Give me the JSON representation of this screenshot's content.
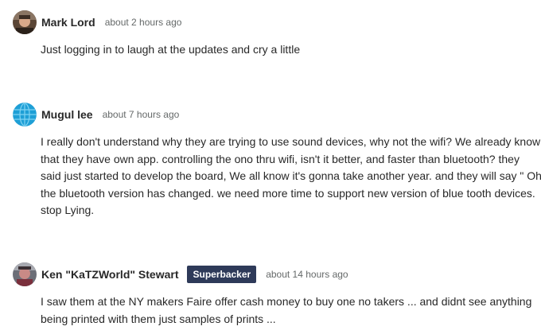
{
  "comments": [
    {
      "author": "Mark Lord",
      "badge": "",
      "time": "about 2 hours ago",
      "body": "Just logging in to laugh at the updates and cry a little"
    },
    {
      "author": "Mugul lee",
      "badge": "",
      "time": "about 7 hours ago",
      "body": "I really don't understand why they are trying to use sound devices, why not the wifi? We already know that they have own app. controlling the ono thru wifi, isn't it better, and faster than bluetooth? they said just started to develop the board, We all know it's gonna take another year. and they will say \" Oh the bluetooth version has changed. we need more time to support new version of blue tooth devices. stop Lying."
    },
    {
      "author": "Ken \"KaTZWorld\" Stewart",
      "badge": "Superbacker",
      "time": "about 14 hours ago",
      "body": "I saw them at the NY makers Faire offer cash money to buy one no takers ... and didnt see anything being printed with them just samples of prints ..."
    }
  ],
  "colors": {
    "badge_bg": "#2e3a59",
    "text": "#282828",
    "meta": "#656969"
  }
}
